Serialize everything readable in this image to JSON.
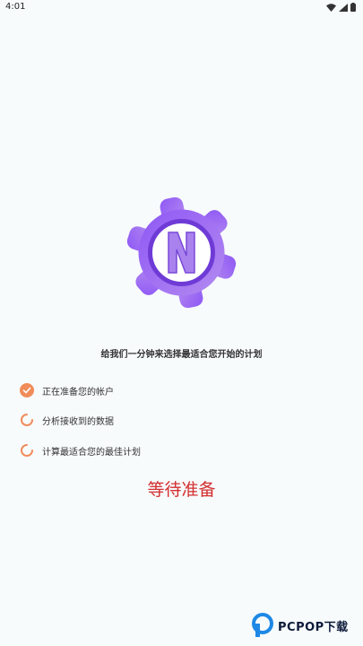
{
  "status_bar": {
    "time": "4:01"
  },
  "subtitle": "给我们一分钟来选择最适合您开始的计划",
  "tasks": [
    {
      "label": "正在准备您的帐户",
      "state": "done"
    },
    {
      "label": "分析接收到的数据",
      "state": "loading"
    },
    {
      "label": "计算最适合您的最佳计划",
      "state": "loading"
    }
  ],
  "wait_button": {
    "label": "等待准备"
  },
  "watermark": {
    "text": "PCPOP下载"
  },
  "colors": {
    "accent_orange": "#f08c5a",
    "wait_red": "#d32f2f",
    "logo_purple": "#8a4cf0"
  },
  "icons": [
    "wifi-icon",
    "signal-icon",
    "battery-icon",
    "check-icon",
    "spinner-icon"
  ]
}
